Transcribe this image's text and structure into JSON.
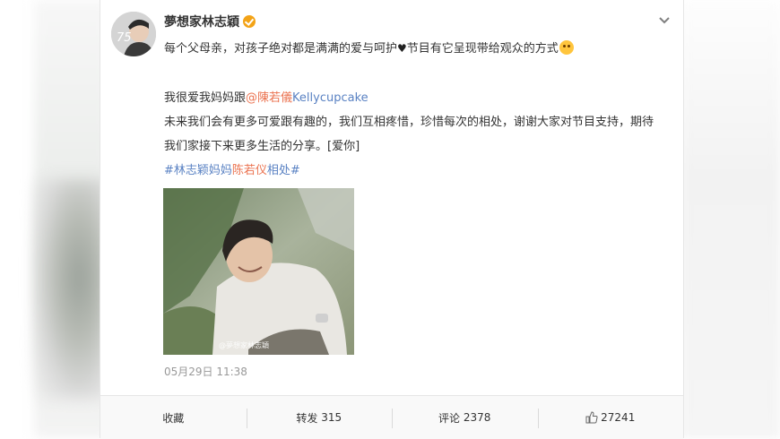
{
  "post": {
    "author": "夢想家林志穎",
    "avatar_text": "75",
    "line1_text": "每个父母亲，对孩子绝对都是满满的爱与呵护",
    "line1_heart": "♥",
    "line1_tail": "节目有它呈现带给观众的方式",
    "line2_prefix": "我很爱我妈妈跟",
    "line2_mention_cn": "@陳若儀",
    "line2_mention_en": "Kellycupcake",
    "line3": "未来我们会有更多可爱跟有趣的，我们互相疼惜，珍惜每次的相处，谢谢大家对节目支持，期待",
    "line4": "我们家接下来更多生活的分享。[爱你]",
    "hashtag_a": "#林志颖妈妈",
    "hashtag_b": "陈若仪",
    "hashtag_c": "相处#",
    "photo_watermark": "@夢想家林志穎",
    "timestamp": "05月29日 11:38"
  },
  "actions": {
    "favorite": "收藏",
    "repost_label": "转发",
    "repost_count": "315",
    "comment_label": "评论",
    "comment_count": "2378",
    "like_count": "27241"
  },
  "icons": [
    "verified-badge-icon",
    "chevron-down-icon",
    "tongue-emoji-icon",
    "thumbs-up-icon"
  ],
  "colors": {
    "mention_red": "#eb7350",
    "link_blue": "#5a82c3",
    "verified_orange": "#f3a317"
  }
}
